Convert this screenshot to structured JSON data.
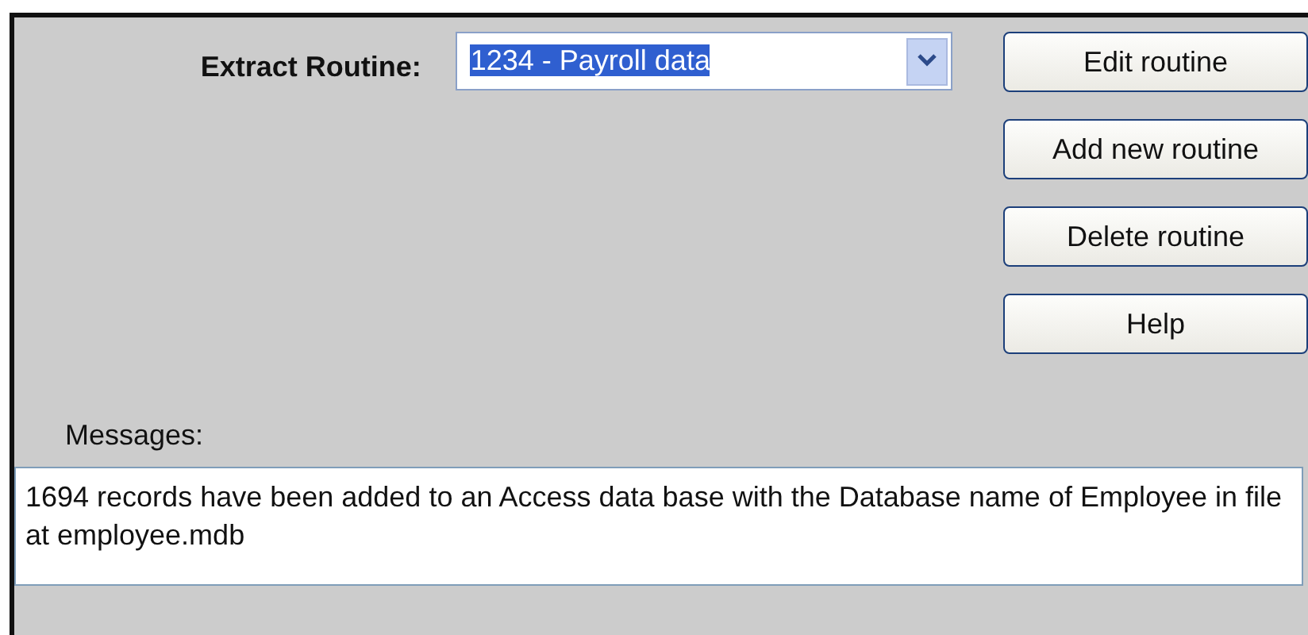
{
  "extract_routine": {
    "label": "Extract Routine:",
    "value": "1234 - Payroll data",
    "value_selected": true
  },
  "buttons": [
    "Edit routine",
    "Add new routine",
    "Delete routine",
    "Help"
  ],
  "messages": {
    "label": "Messages:",
    "text": "1694 records have been added to an Access data base with the Database name of Employee in file at employee.mdb"
  }
}
